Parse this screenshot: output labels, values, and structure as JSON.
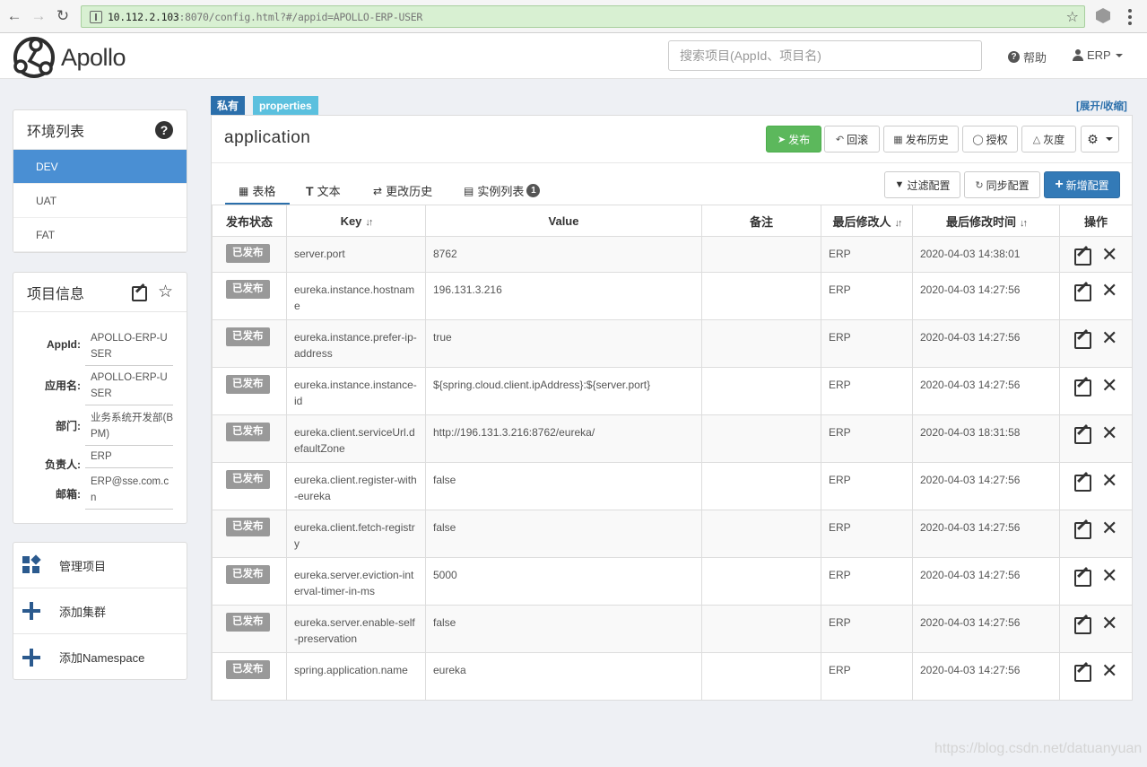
{
  "browser": {
    "url_host": "10.112.2.103",
    "url_rest": ":8070/config.html?#/appid=APOLLO-ERP-USER"
  },
  "navbar": {
    "brand": "Apollo",
    "search_placeholder": "搜索项目(AppId、项目名)",
    "help_label": "帮助",
    "user_label": "ERP"
  },
  "env_panel": {
    "title": "环境列表",
    "items": [
      "DEV",
      "UAT",
      "FAT"
    ],
    "active": "DEV"
  },
  "project_info": {
    "title": "项目信息",
    "rows": [
      {
        "label": "AppId:",
        "value": "APOLLO-ERP-USER"
      },
      {
        "label": "应用名:",
        "value": "APOLLO-ERP-USER"
      },
      {
        "label": "部门:",
        "value": "业务系统开发部(BPM)"
      },
      {
        "label": "负责人:",
        "value": "ERP"
      },
      {
        "label": "邮箱:",
        "value": "ERP@sse.com.cn"
      }
    ]
  },
  "manage_panel": {
    "items": [
      "管理项目",
      "添加集群",
      "添加Namespace"
    ]
  },
  "namespace": {
    "tag_private": "私有",
    "tag_format": "properties",
    "expand_label": "[展开/收缩]",
    "name": "application",
    "buttons": {
      "publish": "发布",
      "rollback": "回滚",
      "history": "发布历史",
      "authorize": "授权",
      "gray": "灰度"
    },
    "tabs": [
      "表格",
      "文本",
      "更改历史",
      "实例列表"
    ],
    "instance_count": "1",
    "actions": {
      "filter": "过滤配置",
      "sync": "同步配置",
      "add": "新增配置"
    },
    "columns": [
      "发布状态",
      "Key",
      "Value",
      "备注",
      "最后修改人",
      "最后修改时间",
      "操作"
    ],
    "rows": [
      {
        "status": "已发布",
        "key": "server.port",
        "value": "8762",
        "comment": "",
        "modifier": "ERP",
        "time": "2020-04-03 14:38:01"
      },
      {
        "status": "已发布",
        "key": "eureka.instance.hostname",
        "value": "196.131.3.216",
        "comment": "",
        "modifier": "ERP",
        "time": "2020-04-03 14:27:56"
      },
      {
        "status": "已发布",
        "key": "eureka.instance.prefer-ip-address",
        "value": "true",
        "comment": "",
        "modifier": "ERP",
        "time": "2020-04-03 14:27:56"
      },
      {
        "status": "已发布",
        "key": "eureka.instance.instance-id",
        "value": "${spring.cloud.client.ipAddress}:${server.port}",
        "comment": "",
        "modifier": "ERP",
        "time": "2020-04-03 14:27:56"
      },
      {
        "status": "已发布",
        "key": "eureka.client.serviceUrl.defaultZone",
        "value": "http://196.131.3.216:8762/eureka/",
        "comment": "",
        "modifier": "ERP",
        "time": "2020-04-03 18:31:58"
      },
      {
        "status": "已发布",
        "key": "eureka.client.register-with-eureka",
        "value": "false",
        "comment": "",
        "modifier": "ERP",
        "time": "2020-04-03 14:27:56"
      },
      {
        "status": "已发布",
        "key": "eureka.client.fetch-registry",
        "value": "false",
        "comment": "",
        "modifier": "ERP",
        "time": "2020-04-03 14:27:56"
      },
      {
        "status": "已发布",
        "key": "eureka.server.eviction-interval-timer-in-ms",
        "value": "5000",
        "comment": "",
        "modifier": "ERP",
        "time": "2020-04-03 14:27:56"
      },
      {
        "status": "已发布",
        "key": "eureka.server.enable-self-preservation",
        "value": "false",
        "comment": "",
        "modifier": "ERP",
        "time": "2020-04-03 14:27:56"
      },
      {
        "status": "已发布",
        "key": "spring.application.name",
        "value": "eureka",
        "comment": "",
        "modifier": "ERP",
        "time": "2020-04-03 14:27:56"
      }
    ]
  },
  "watermark": "https://blog.csdn.net/datuanyuan",
  "colors": {
    "active_env": "#4a8fd3",
    "publish_button": "#5cb85c",
    "add_button": "#337ab7",
    "tag_private": "#2b6fab",
    "tag_properties": "#5bc0de",
    "status_badge": "#999999"
  }
}
